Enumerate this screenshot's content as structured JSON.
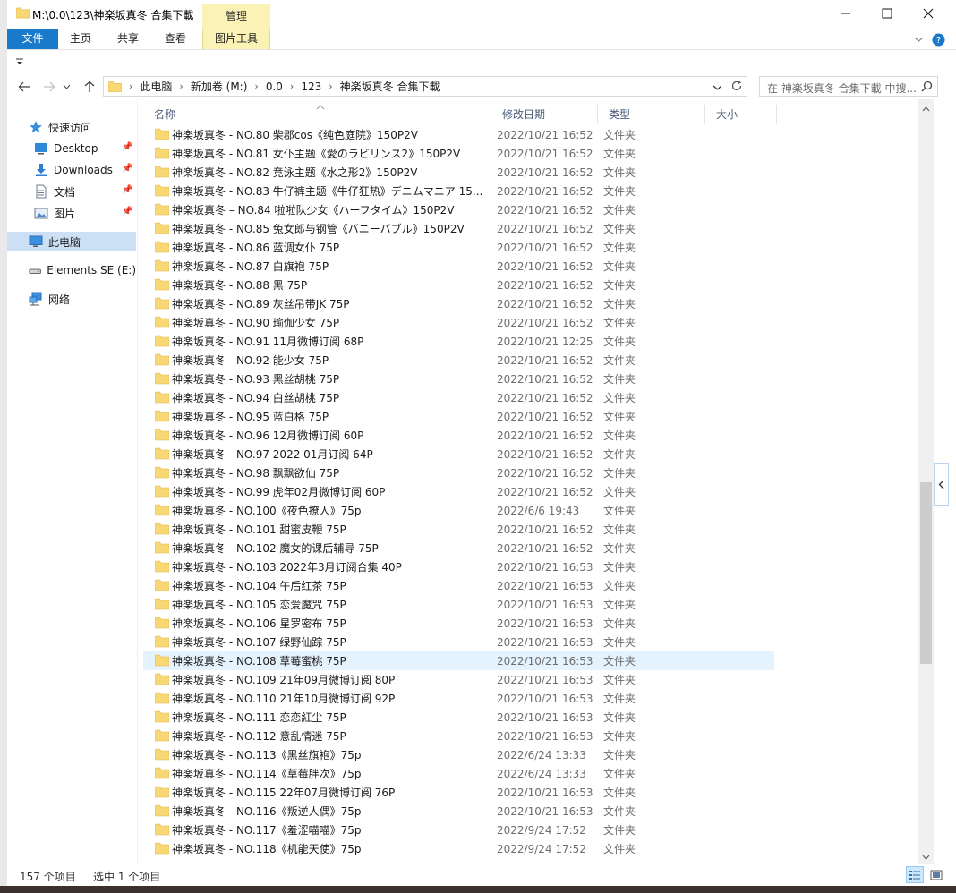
{
  "window": {
    "title": "M:\\0.0\\123\\神楽坂真冬 合集下載",
    "context_tab": "管理"
  },
  "ribbon": {
    "tabs": [
      "文件",
      "主页",
      "共享",
      "查看",
      "图片工具"
    ]
  },
  "address": {
    "crumbs": [
      "此电脑",
      "新加卷 (M:)",
      "0.0",
      "123",
      "神楽坂真冬 合集下載"
    ],
    "search_placeholder": "在 神楽坂真冬 合集下載 中搜..."
  },
  "nav": {
    "quick_access": "快速访问",
    "items": [
      "Desktop",
      "Downloads",
      "文档",
      "图片"
    ],
    "this_pc": "此电脑",
    "drive": "Elements SE (E:)",
    "network": "网络"
  },
  "columns": {
    "name": "名称",
    "date": "修改日期",
    "type": "类型",
    "size": "大小"
  },
  "files": [
    {
      "name": "神楽坂真冬 - NO.80 柴郡cos《纯色庭院》150P2V",
      "date": "2022/10/21 16:52",
      "type": "文件夹"
    },
    {
      "name": "神楽坂真冬 - NO.81 女仆主题《愛のラビリンス2》150P2V",
      "date": "2022/10/21 16:52",
      "type": "文件夹"
    },
    {
      "name": "神楽坂真冬 - NO.82 竞泳主题《水之形2》150P2V",
      "date": "2022/10/21 16:52",
      "type": "文件夹"
    },
    {
      "name": "神楽坂真冬 - NO.83 牛仔裤主题《牛仔狂热》デニムマニア 15...",
      "date": "2022/10/21 16:52",
      "type": "文件夹"
    },
    {
      "name": "神楽坂真冬 – NO.84 啦啦队少女《ハーフタイム》150P2V",
      "date": "2022/10/21 16:52",
      "type": "文件夹"
    },
    {
      "name": "神楽坂真冬 - NO.85 兔女郎与钢管《バニーバブル》150P2V",
      "date": "2022/10/21 16:52",
      "type": "文件夹"
    },
    {
      "name": "神楽坂真冬 - NO.86 蓝调女仆 75P",
      "date": "2022/10/21 16:52",
      "type": "文件夹"
    },
    {
      "name": "神楽坂真冬 - NO.87 白旗袍 75P",
      "date": "2022/10/21 16:52",
      "type": "文件夹"
    },
    {
      "name": "神楽坂真冬 - NO.88 黑 75P",
      "date": "2022/10/21 16:52",
      "type": "文件夹"
    },
    {
      "name": "神楽坂真冬 - NO.89 灰丝吊带JK 75P",
      "date": "2022/10/21 16:52",
      "type": "文件夹"
    },
    {
      "name": "神楽坂真冬 - NO.90 瑜伽少女 75P",
      "date": "2022/10/21 16:52",
      "type": "文件夹"
    },
    {
      "name": "神楽坂真冬 - NO.91 11月微博订阅 68P",
      "date": "2022/10/21 12:25",
      "type": "文件夹"
    },
    {
      "name": "神楽坂真冬 - NO.92 能少女 75P",
      "date": "2022/10/21 16:52",
      "type": "文件夹"
    },
    {
      "name": "神楽坂真冬 - NO.93 黑丝胡桃 75P",
      "date": "2022/10/21 16:52",
      "type": "文件夹"
    },
    {
      "name": "神楽坂真冬 - NO.94 白丝胡桃 75P",
      "date": "2022/10/21 16:52",
      "type": "文件夹"
    },
    {
      "name": "神楽坂真冬 - NO.95 蓝白格 75P",
      "date": "2022/10/21 16:52",
      "type": "文件夹"
    },
    {
      "name": "神楽坂真冬 - NO.96 12月微博订阅 60P",
      "date": "2022/10/21 16:52",
      "type": "文件夹"
    },
    {
      "name": "神楽坂真冬 - NO.97 2022 01月订阅 64P",
      "date": "2022/10/21 16:52",
      "type": "文件夹"
    },
    {
      "name": "神楽坂真冬 - NO.98 飘飘欲仙 75P",
      "date": "2022/10/21 16:52",
      "type": "文件夹"
    },
    {
      "name": "神楽坂真冬 - NO.99 虎年02月微博订阅 60P",
      "date": "2022/10/21 16:52",
      "type": "文件夹"
    },
    {
      "name": "神楽坂真冬 - NO.100《夜色撩人》75p",
      "date": "2022/6/6 19:43",
      "type": "文件夹"
    },
    {
      "name": "神楽坂真冬 - NO.101 甜蜜皮鞭 75P",
      "date": "2022/10/21 16:52",
      "type": "文件夹"
    },
    {
      "name": "神楽坂真冬 - NO.102 魔女的课后辅导 75P",
      "date": "2022/10/21 16:52",
      "type": "文件夹"
    },
    {
      "name": "神楽坂真冬 - NO.103 2022年3月订阅合集 40P",
      "date": "2022/10/21 16:53",
      "type": "文件夹"
    },
    {
      "name": "神楽坂真冬 - NO.104 午后红茶 75P",
      "date": "2022/10/21 16:53",
      "type": "文件夹"
    },
    {
      "name": "神楽坂真冬 - NO.105 恋爱魔咒 75P",
      "date": "2022/10/21 16:53",
      "type": "文件夹"
    },
    {
      "name": "神楽坂真冬 - NO.106 星罗密布 75P",
      "date": "2022/10/21 16:53",
      "type": "文件夹"
    },
    {
      "name": "神楽坂真冬 - NO.107 绿野仙踪 75P",
      "date": "2022/10/21 16:53",
      "type": "文件夹"
    },
    {
      "name": "神楽坂真冬 - NO.108 草莓蜜桃 75P",
      "date": "2022/10/21 16:53",
      "type": "文件夹"
    },
    {
      "name": "神楽坂真冬 - NO.109 21年09月微博订阅 80P",
      "date": "2022/10/21 16:53",
      "type": "文件夹"
    },
    {
      "name": "神楽坂真冬 - NO.110 21年10月微博订阅 92P",
      "date": "2022/10/21 16:53",
      "type": "文件夹"
    },
    {
      "name": "神楽坂真冬 - NO.111 恋恋紅尘 75P",
      "date": "2022/10/21 16:53",
      "type": "文件夹"
    },
    {
      "name": "神楽坂真冬 - NO.112 意乱情迷 75P",
      "date": "2022/10/21 16:53",
      "type": "文件夹"
    },
    {
      "name": "神楽坂真冬 - NO.113《黑丝旗袍》75p",
      "date": "2022/6/24 13:33",
      "type": "文件夹"
    },
    {
      "name": "神楽坂真冬 - NO.114《草莓胖次》75p",
      "date": "2022/6/24 13:33",
      "type": "文件夹"
    },
    {
      "name": "神楽坂真冬 - NO.115 22年07月微博订阅 76P",
      "date": "2022/10/21 16:53",
      "type": "文件夹"
    },
    {
      "name": "神楽坂真冬 - NO.116《叛逆人偶》75p",
      "date": "2022/10/21 16:53",
      "type": "文件夹"
    },
    {
      "name": "神楽坂真冬 - NO.117《羞涩喵喵》75p",
      "date": "2022/9/24 17:52",
      "type": "文件夹"
    },
    {
      "name": "神楽坂真冬 - NO.118《机能天使》75p",
      "date": "2022/9/24 17:52",
      "type": "文件夹"
    }
  ],
  "highlighted_index": 28,
  "status": {
    "count": "157 个项目",
    "selected": "选中 1 个项目"
  },
  "colors": {
    "accent": "#1979ca",
    "folder": "#f8d775",
    "selection": "#cce0f5",
    "hover_row": "#e5f3ff",
    "picture_tools": "#fbf3b5"
  }
}
